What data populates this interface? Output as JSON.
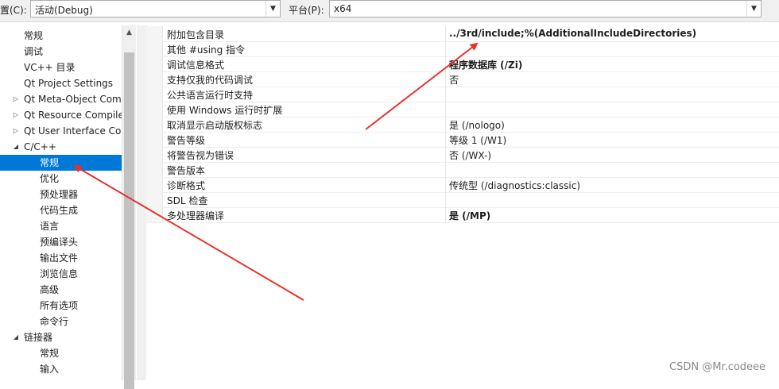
{
  "toolbar": {
    "config_label": "置(C):",
    "config_value": "活动(Debug)",
    "platform_label": "平台(P):",
    "platform_value": "x64"
  },
  "tree": {
    "items": [
      {
        "label": "常规",
        "expander": ""
      },
      {
        "label": "调试",
        "expander": ""
      },
      {
        "label": "VC++ 目录",
        "expander": ""
      },
      {
        "label": "Qt Project Settings",
        "expander": ""
      },
      {
        "label": "Qt Meta-Object Com",
        "expander": "▷"
      },
      {
        "label": "Qt Resource Compile",
        "expander": "▷"
      },
      {
        "label": "Qt User Interface Co",
        "expander": "▷"
      },
      {
        "label": "C/C++",
        "expander": "◢"
      },
      {
        "label": "常规",
        "expander": ""
      },
      {
        "label": "优化",
        "expander": ""
      },
      {
        "label": "预处理器",
        "expander": ""
      },
      {
        "label": "代码生成",
        "expander": ""
      },
      {
        "label": "语言",
        "expander": ""
      },
      {
        "label": "预编译头",
        "expander": ""
      },
      {
        "label": "输出文件",
        "expander": ""
      },
      {
        "label": "浏览信息",
        "expander": ""
      },
      {
        "label": "高级",
        "expander": ""
      },
      {
        "label": "所有选项",
        "expander": ""
      },
      {
        "label": "命令行",
        "expander": ""
      },
      {
        "label": "链接器",
        "expander": "◢"
      },
      {
        "label": "常规",
        "expander": ""
      },
      {
        "label": "输入",
        "expander": ""
      }
    ]
  },
  "properties": [
    {
      "name": "附加包含目录",
      "value": "../3rd/include;%(AdditionalIncludeDirectories)",
      "bold": true
    },
    {
      "name": "其他 #using 指令",
      "value": "",
      "bold": false
    },
    {
      "name": "调试信息格式",
      "value": "程序数据库 (/Zi)",
      "bold": true
    },
    {
      "name": "支持仅我的代码调试",
      "value": "否",
      "bold": false
    },
    {
      "name": "公共语言运行时支持",
      "value": "",
      "bold": false
    },
    {
      "name": "使用 Windows 运行时扩展",
      "value": "",
      "bold": false
    },
    {
      "name": "取消显示启动版权标志",
      "value": "是 (/nologo)",
      "bold": false
    },
    {
      "name": "警告等级",
      "value": "等级 1 (/W1)",
      "bold": false
    },
    {
      "name": "将警告视为错误",
      "value": "否 (/WX-)",
      "bold": false
    },
    {
      "name": "警告版本",
      "value": "",
      "bold": false
    },
    {
      "name": "诊断格式",
      "value": "传统型 (/diagnostics:classic)",
      "bold": false
    },
    {
      "name": "SDL 检查",
      "value": "",
      "bold": false
    },
    {
      "name": "多处理器编译",
      "value": "是 (/MP)",
      "bold": true
    }
  ],
  "watermark": "CSDN @Mr.codeee",
  "colors": {
    "selection": "#0078d7",
    "annotation_arrow": "#e8312a"
  }
}
